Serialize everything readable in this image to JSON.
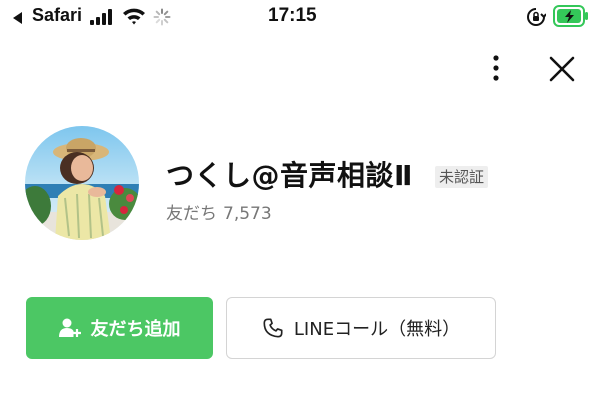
{
  "status_bar": {
    "back_app": "Safari",
    "time": "17:15",
    "icons": [
      "back-arrow-icon",
      "signal-icon",
      "wifi-icon",
      "loading-spinner-icon",
      "rotation-lock-icon",
      "battery-charging-icon"
    ],
    "battery_color": "#34c759"
  },
  "header": {
    "icons": [
      "more-vertical-icon",
      "close-icon"
    ]
  },
  "profile": {
    "name": "つくし@音声相談Ⅱ",
    "badge": "未認証",
    "friends_label": "友だち",
    "friends_count": "7,573"
  },
  "actions": {
    "add_friend_label": "友だち追加",
    "line_call_label": "LINEコール（無料）",
    "accent_color": "#4cc764"
  }
}
